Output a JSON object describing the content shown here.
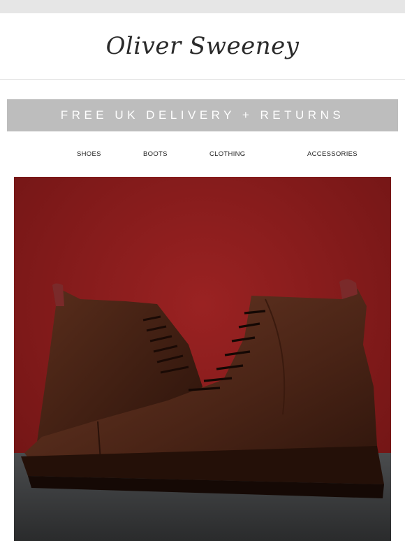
{
  "brand": {
    "logo_text": "Oliver Sweeney"
  },
  "promo_banner": {
    "text": "FREE UK DELIVERY + RETURNS"
  },
  "nav": {
    "items": [
      {
        "label": "SHOES"
      },
      {
        "label": "BOOTS"
      },
      {
        "label": "CLOTHING"
      },
      {
        "label": "ACCESSORIES"
      }
    ]
  },
  "hero": {
    "background_color": "#8b1c1c",
    "floor_color": "#3a3c3e",
    "product_color": "#5a2e1c"
  }
}
